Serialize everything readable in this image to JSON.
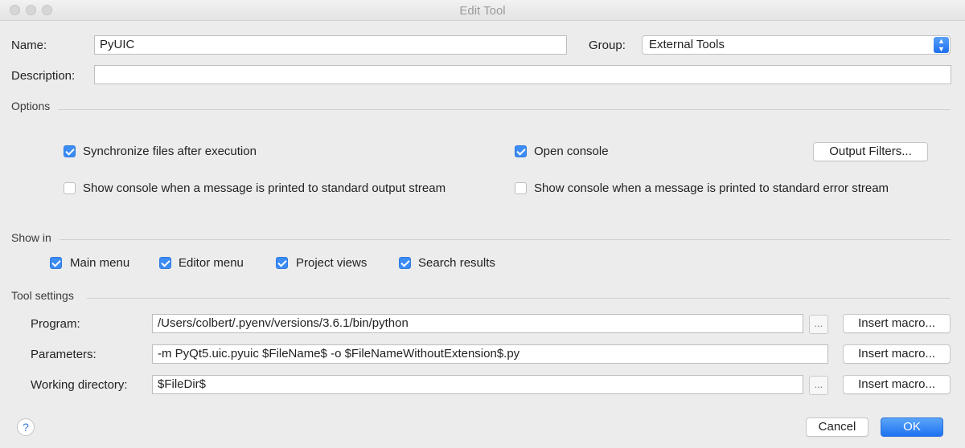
{
  "window": {
    "title": "Edit Tool"
  },
  "form": {
    "name_label": "Name:",
    "name_value": "PyUIC",
    "group_label": "Group:",
    "group_value": "External Tools",
    "description_label": "Description:",
    "description_value": ""
  },
  "options": {
    "title": "Options",
    "sync_files": {
      "label": "Synchronize files after execution",
      "checked": true
    },
    "open_console": {
      "label": "Open console",
      "checked": true
    },
    "output_filters_label": "Output Filters...",
    "show_stdout": {
      "label": "Show console when a message is printed to standard output stream",
      "checked": false
    },
    "show_stderr": {
      "label": "Show console when a message is printed to standard error stream",
      "checked": false
    }
  },
  "show_in": {
    "title": "Show in",
    "items": [
      {
        "label": "Main menu",
        "checked": true
      },
      {
        "label": "Editor menu",
        "checked": true
      },
      {
        "label": "Project views",
        "checked": true
      },
      {
        "label": "Search results",
        "checked": true
      }
    ]
  },
  "tool_settings": {
    "title": "Tool settings",
    "program_label": "Program:",
    "program_value": "/Users/colbert/.pyenv/versions/3.6.1/bin/python",
    "parameters_label": "Parameters:",
    "parameters_value": "-m PyQt5.uic.pyuic  $FileName$ -o $FileNameWithoutExtension$.py",
    "working_dir_label": "Working directory:",
    "working_dir_value": "$FileDir$",
    "insert_macro_label": "Insert macro...",
    "browse_label": "..."
  },
  "footer": {
    "help_label": "?",
    "cancel_label": "Cancel",
    "ok_label": "OK"
  },
  "colors": {
    "accent": "#3b8cf3",
    "background": "#ececec"
  }
}
